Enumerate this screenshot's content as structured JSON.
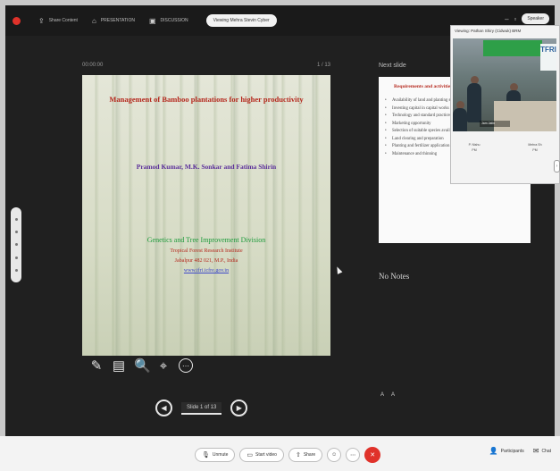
{
  "toolbar": {
    "items": [
      {
        "icon": "share-icon",
        "glyph": "⇪",
        "label": "Share Content"
      },
      {
        "icon": "presentation-icon",
        "glyph": "⌂",
        "label": "PRESENTATION"
      },
      {
        "icon": "tools-icon",
        "glyph": "▣",
        "label": "DISCUSSION"
      }
    ],
    "pill_label": "Viewing Mehra Stevin Cyber",
    "right_label": "Speaker"
  },
  "slide": {
    "header_left": "00:00:00",
    "header_right": "1 / 13",
    "title": "Management of Bamboo plantations for higher productivity",
    "authors": "Pramod Kumar, M.K. Sonkar and Fatima Shirin",
    "division": "Genetics and Tree Improvement Division",
    "institute": "Tropical Forest Research Institute",
    "city": "Jabalpur 482 021, M.P., India",
    "web": "www.tfri.icfre.gov.in"
  },
  "nav": {
    "label": "Slide 1 of 13",
    "prev": "◀",
    "next": "▶"
  },
  "tools": {
    "pen": "✎",
    "slides": "▤",
    "zoom": "🔍",
    "pointer": "⌖",
    "more": "⋯"
  },
  "next_slide": {
    "heading": "Next slide",
    "title": "Requirements and activities",
    "bullets": [
      "Availability of land and planting stock",
      "Investing capital in capital works",
      "Technology and standard practices",
      "Marketing opportunity",
      "Selection of suitable species available",
      "Land clearing and preparation",
      "Planting and fertilizer application",
      "Maintenance and thinning"
    ]
  },
  "notes": {
    "text": "No Notes",
    "font_small": "A",
    "font_large": "A"
  },
  "video": {
    "caption": "Viewing: Pathan Shiry (Cidwuk) BRM",
    "banner_text": "TFRI",
    "name_tag": "Jam Jatin",
    "tiles": [
      {
        "name": "P. Nishu",
        "sub": "PM"
      },
      {
        "name": "Mehra Sh",
        "sub": "PM"
      }
    ]
  },
  "bottombar": {
    "buttons": [
      {
        "icon": "mic-icon",
        "glyph": "🎙",
        "label": "Unmute"
      },
      {
        "icon": "video-icon",
        "glyph": "▭",
        "label": "Start video"
      },
      {
        "icon": "share-icon",
        "glyph": "⇧",
        "label": "Share"
      }
    ],
    "right": [
      {
        "icon": "participants-icon",
        "glyph": "👤",
        "label": "Participants"
      },
      {
        "icon": "chat-icon",
        "glyph": "✉",
        "label": "Chat"
      }
    ]
  },
  "colors": {
    "accent_red": "#e0322a",
    "title_red": "#b5291e",
    "author_purple": "#5b2f9a",
    "division_green": "#1c9a3a"
  }
}
